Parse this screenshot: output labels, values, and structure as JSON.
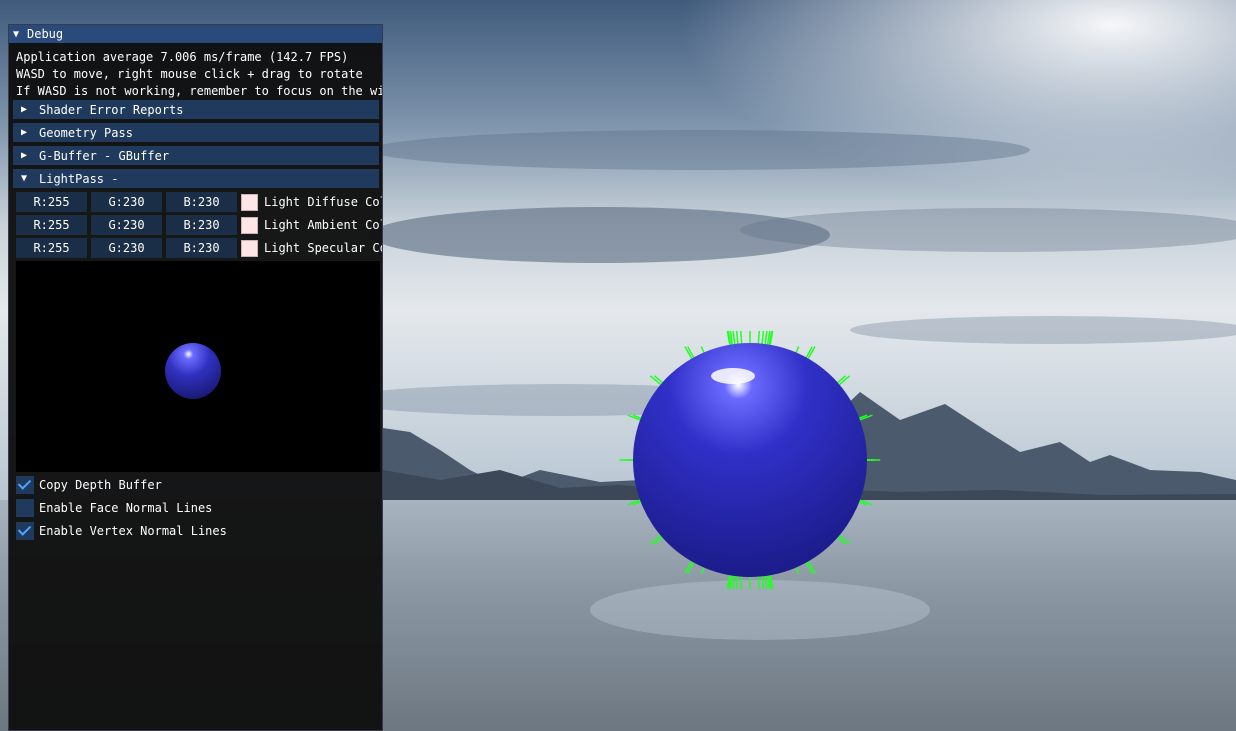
{
  "window": {
    "title": "Debug",
    "lines": [
      "Application average 7.006 ms/frame (142.7 FPS)",
      "WASD to move, right mouse click + drag to rotate",
      "If WASD is not working, remember to focus on the window"
    ],
    "headers": [
      {
        "label": "Shader Error Reports",
        "expanded": false
      },
      {
        "label": "Geometry Pass",
        "expanded": false
      },
      {
        "label": "G-Buffer - GBuffer",
        "expanded": false
      },
      {
        "label": "LightPass -",
        "expanded": true
      }
    ],
    "color_rows": [
      {
        "r": "R:255",
        "g": "G:230",
        "b": "B:230",
        "swatch": "#ffe6e6",
        "label": "Light Diffuse Color"
      },
      {
        "r": "R:255",
        "g": "G:230",
        "b": "B:230",
        "swatch": "#ffe6e6",
        "label": "Light Ambient Color"
      },
      {
        "r": "R:255",
        "g": "G:230",
        "b": "B:230",
        "swatch": "#ffe6e6",
        "label": "Light Specular Color"
      }
    ],
    "checkboxes": [
      {
        "label": "Copy Depth Buffer",
        "checked": true
      },
      {
        "label": "Enable Face Normal Lines",
        "checked": false
      },
      {
        "label": "Enable Vertex Normal Lines",
        "checked": true
      }
    ]
  },
  "colors": {
    "title_bar": "#294a7a",
    "header": "#1f3a5c",
    "sphere": "#2b2bb0",
    "normal_lines": "#22ff22"
  }
}
